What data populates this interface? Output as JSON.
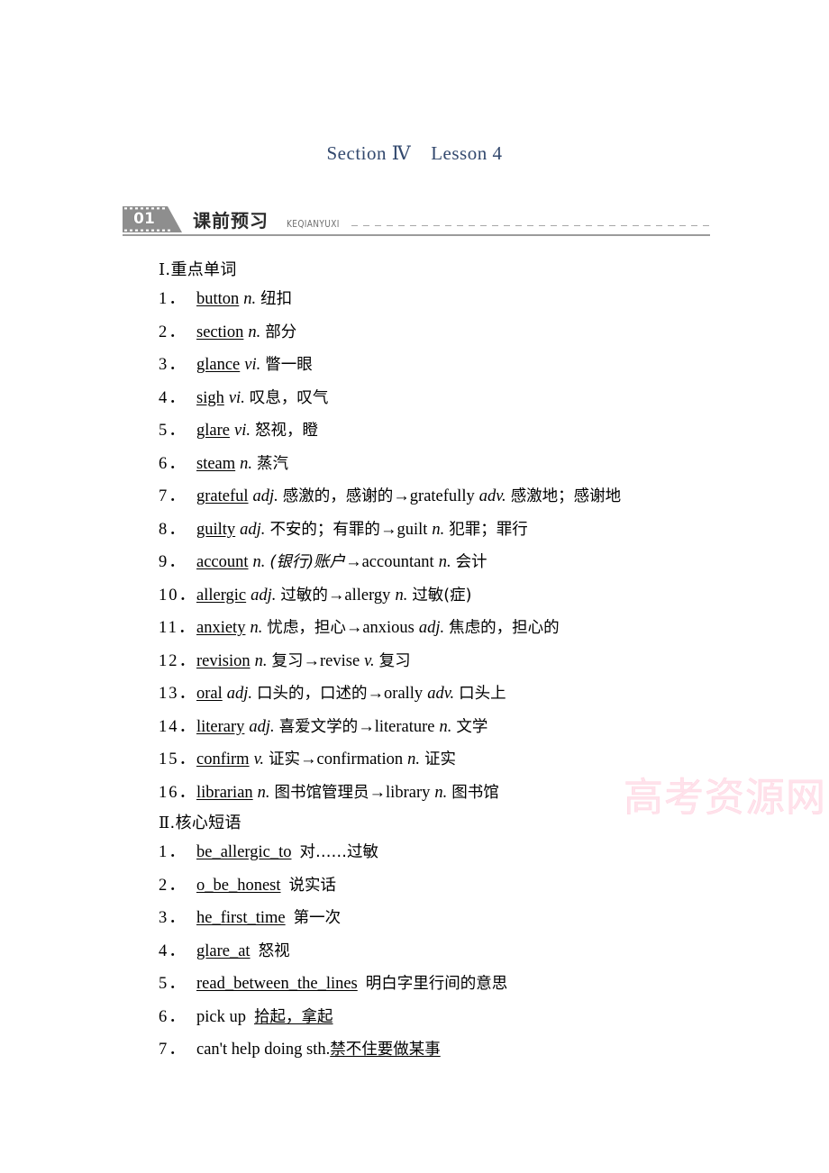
{
  "page": {
    "title_left": "Section Ⅳ",
    "title_right": "Lesson 4"
  },
  "section_header": {
    "number": "01",
    "title_cn": "课前预习",
    "pinyin": "KEQIANYUXI",
    "rule_color": "#9b9b9b",
    "badge_color": "#8e8e8e"
  },
  "watermark": {
    "text": "高考资源网",
    "color": "#ffd8e4"
  },
  "groups": [
    {
      "roman": "Ⅰ",
      "heading_cn": ".重点单词",
      "items": [
        {
          "num": "1．",
          "word": "button",
          "pos": "n.",
          "cn": "纽扣"
        },
        {
          "num": "2．",
          "word": "section",
          "pos": "n.",
          "cn": "部分"
        },
        {
          "num": "3．",
          "word": "glance",
          "pos": "vi.",
          "cn": "瞥一眼"
        },
        {
          "num": "4．",
          "word": "sigh",
          "pos": "vi.",
          "cn": "叹息，叹气"
        },
        {
          "num": "5．",
          "word": "glare",
          "pos": "vi.",
          "cn": "怒视，瞪"
        },
        {
          "num": "6．",
          "word": "steam",
          "pos": "n.",
          "cn": "蒸汽"
        },
        {
          "num": "7．",
          "word": "grateful",
          "pos": "adj.",
          "cn": "感激的，感谢的",
          "arrow": "→",
          "word2": "gratefully",
          "pos2": "adv.",
          "cn2": "感激地；感谢地"
        },
        {
          "num": "8．",
          "word": "guilty",
          "pos": "adj.",
          "cn": "不安的；有罪的",
          "arrow": "→",
          "word2": "guilt",
          "pos2": "n.",
          "cn2": "犯罪；罪行"
        },
        {
          "num": "9．",
          "word": "account",
          "pos": "n.",
          "cn": "(银行)账户",
          "cn_italic": true,
          "arrow": "→",
          "word2": "accountant",
          "pos2": "n.",
          "cn2": "会计"
        },
        {
          "num": "10．",
          "word": "allergic",
          "pos": "adj.",
          "cn": "过敏的",
          "arrow": "→",
          "word2": "allergy",
          "pos2": "n.",
          "cn2": "过敏(症)"
        },
        {
          "num": "11．",
          "word": "anxiety",
          "pos": "n.",
          "cn": "忧虑，担心",
          "arrow": "→",
          "word2": "anxious",
          "pos2": "adj.",
          "cn2": "焦虑的，担心的"
        },
        {
          "num": "12．",
          "word": "revision",
          "pos": "n.",
          "cn": "复习",
          "arrow": "→",
          "word2": "revise",
          "pos2": "v.",
          "cn2": "复习"
        },
        {
          "num": "13．",
          "word": "oral",
          "pos": "adj.",
          "cn": "口头的，口述的",
          "arrow": "→",
          "word2": "orally",
          "pos2": "adv.",
          "cn2": "口头上"
        },
        {
          "num": "14．",
          "word": "literary",
          "pos": "adj.",
          "cn": "喜爱文学的",
          "arrow": "→",
          "word2": "literature",
          "pos2": "n.",
          "cn2": "文学"
        },
        {
          "num": "15．",
          "word": "confirm",
          "pos": "v.",
          "cn": "证实",
          "arrow": "→",
          "word2": "confirmation",
          "pos2": "n.",
          "cn2": "证实"
        },
        {
          "num": "16．",
          "word": "librarian",
          "pos": "n.",
          "cn": "图书馆管理员",
          "arrow": "→",
          "word2": "library",
          "pos2": "n.",
          "cn2": "图书馆"
        }
      ]
    },
    {
      "roman": "Ⅱ",
      "heading_cn": ".核心短语",
      "items": [
        {
          "num": "1．",
          "phrase": "be_allergic_to",
          "phrase_underlined": true,
          "cn": "对……过敏",
          "cn_underlined": false
        },
        {
          "num": "2．",
          "phrase": "o_be_honest",
          "phrase_underlined": true,
          "cn": "说实话",
          "cn_underlined": false
        },
        {
          "num": "3．",
          "phrase": "he_first_time",
          "phrase_underlined": true,
          "cn": "第一次",
          "cn_underlined": false
        },
        {
          "num": "4．",
          "phrase": "glare_at",
          "phrase_underlined": true,
          "cn": "怒视",
          "cn_underlined": false
        },
        {
          "num": "5．",
          "phrase": "read_between_the_lines",
          "phrase_underlined": true,
          "cn": "明白字里行间的意思",
          "cn_underlined": false
        },
        {
          "num": "6．",
          "phrase": "pick up",
          "phrase_underlined": false,
          "cn": "拾起，拿起",
          "cn_underlined": true
        },
        {
          "num": "7．",
          "phrase": "can't help doing sth.",
          "phrase_underlined": false,
          "cn": "禁不住要做某事",
          "cn_underlined": true,
          "tight": true
        }
      ]
    }
  ]
}
